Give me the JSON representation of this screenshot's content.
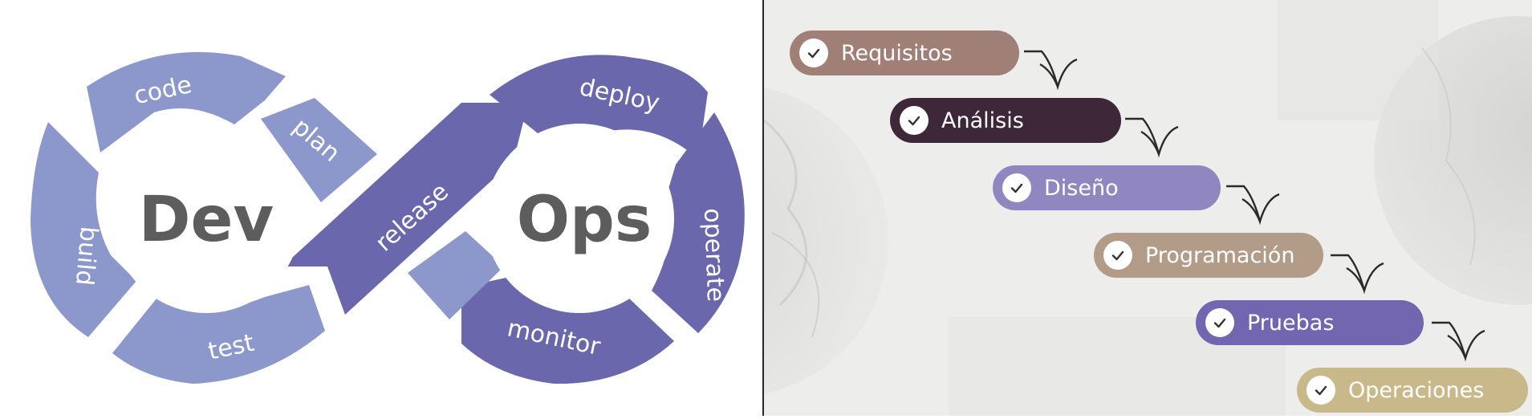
{
  "devops": {
    "hub_dev": "Dev",
    "hub_ops": "Ops",
    "segments": {
      "code": "code",
      "plan": "plan",
      "build": "build",
      "test": "test",
      "release": "release",
      "deploy": "deploy",
      "operate": "operate",
      "monitor": "monitor"
    },
    "colors": {
      "dev_side": "#8c97cb",
      "ops_side": "#6a67ad",
      "hub_text": "#5d5d5d"
    }
  },
  "waterfall": {
    "steps": [
      {
        "label": "Requisitos",
        "color": "#a07f76"
      },
      {
        "label": "Análisis",
        "color": "#3d2738"
      },
      {
        "label": "Diseño",
        "color": "#9187c0"
      },
      {
        "label": "Programación",
        "color": "#b29c88"
      },
      {
        "label": "Pruebas",
        "color": "#7366b0"
      },
      {
        "label": "Operaciones",
        "color": "#c9b88a"
      }
    ],
    "check_icon": "check-circle-icon",
    "arrow_icon": "down-branch-arrow-icon"
  }
}
